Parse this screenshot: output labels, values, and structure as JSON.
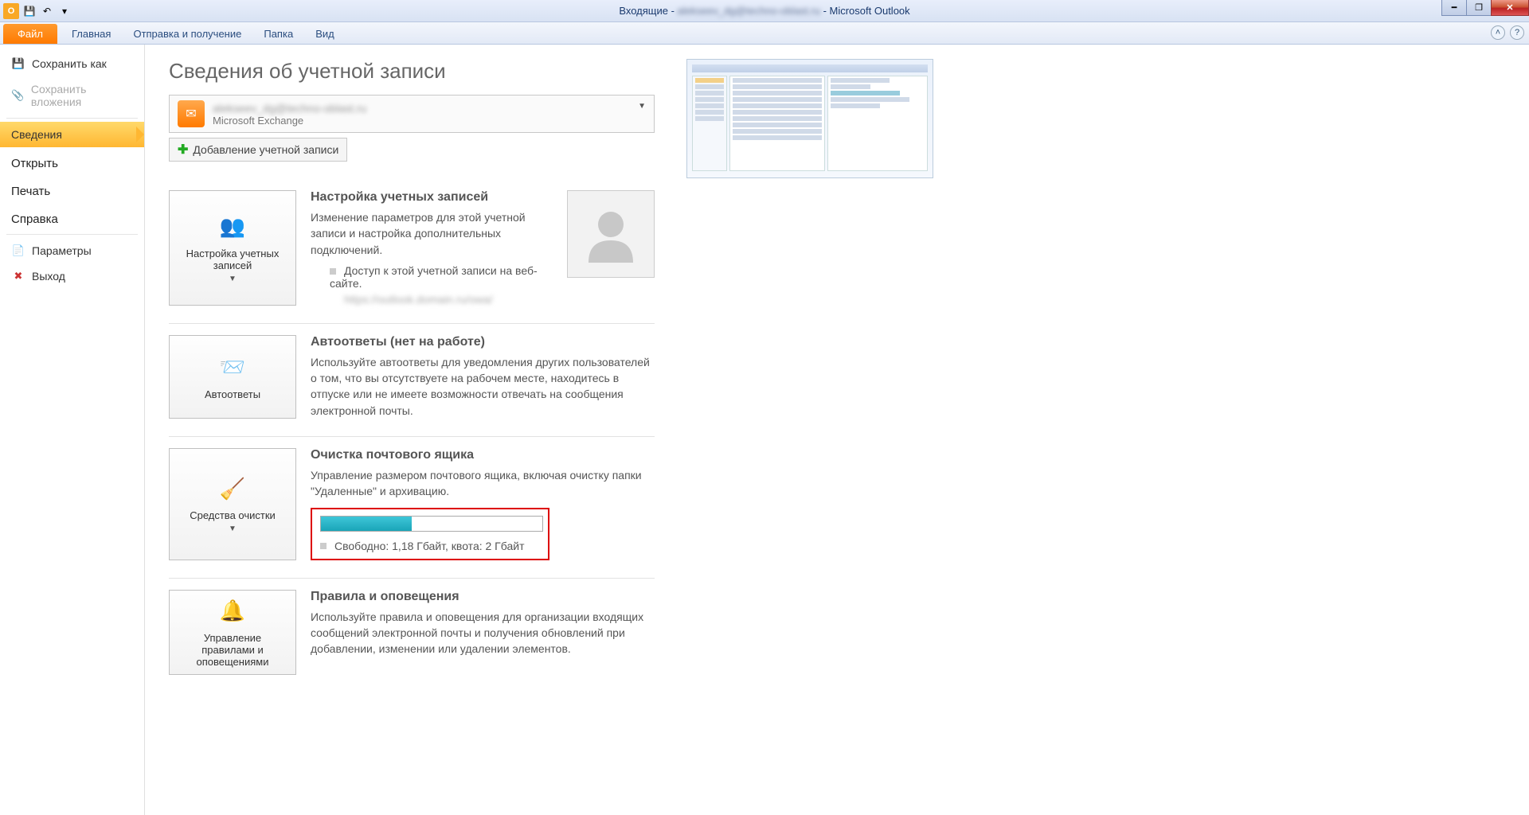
{
  "titlebar": {
    "app_prefix": "Входящие - ",
    "account_blur": "alekseev_dg@techno-oblast.ru",
    "app_suffix": " - Microsoft Outlook"
  },
  "ribbon": {
    "file": "Файл",
    "tabs": [
      "Главная",
      "Отправка и получение",
      "Папка",
      "Вид"
    ]
  },
  "sidebar": {
    "save_as": "Сохранить как",
    "save_attach": "Сохранить вложения",
    "info": "Сведения",
    "open": "Открыть",
    "print": "Печать",
    "help": "Справка",
    "options": "Параметры",
    "exit": "Выход"
  },
  "page": {
    "title": "Сведения об учетной записи",
    "account_email_blur": "alekseev_dg@techno-oblast.ru",
    "account_type": "Microsoft Exchange",
    "add_account": "Добавление учетной записи"
  },
  "sections": {
    "settings": {
      "button": "Настройка учетных записей",
      "title": "Настройка учетных записей",
      "desc": "Изменение параметров для этой учетной записи и настройка дополнительных подключений.",
      "sub1": "Доступ к этой учетной записи на веб-сайте.",
      "sub2_blur": "https://outlook.domain.ru/owa/"
    },
    "auto": {
      "button": "Автоответы",
      "title": "Автоответы (нет на работе)",
      "desc": "Используйте автоответы для уведомления других пользователей о том, что вы отсутствуете на рабочем месте, находитесь в отпуске или не имеете возможности отвечать на сообщения электронной почты."
    },
    "cleanup": {
      "button": "Средства очистки",
      "title": "Очистка почтового ящика",
      "desc": "Управление размером почтового ящика, включая очистку папки \"Удаленные\" и архивацию.",
      "quota_text": "Свободно: 1,18 Гбайт, квота: 2 Гбайт",
      "quota_used_percent": 41
    },
    "rules": {
      "button": "Управление правилами и оповещениями",
      "title": "Правила и оповещения",
      "desc": "Используйте правила и оповещения для организации входящих сообщений электронной почты и получения обновлений при добавлении, изменении или удалении элементов."
    }
  }
}
